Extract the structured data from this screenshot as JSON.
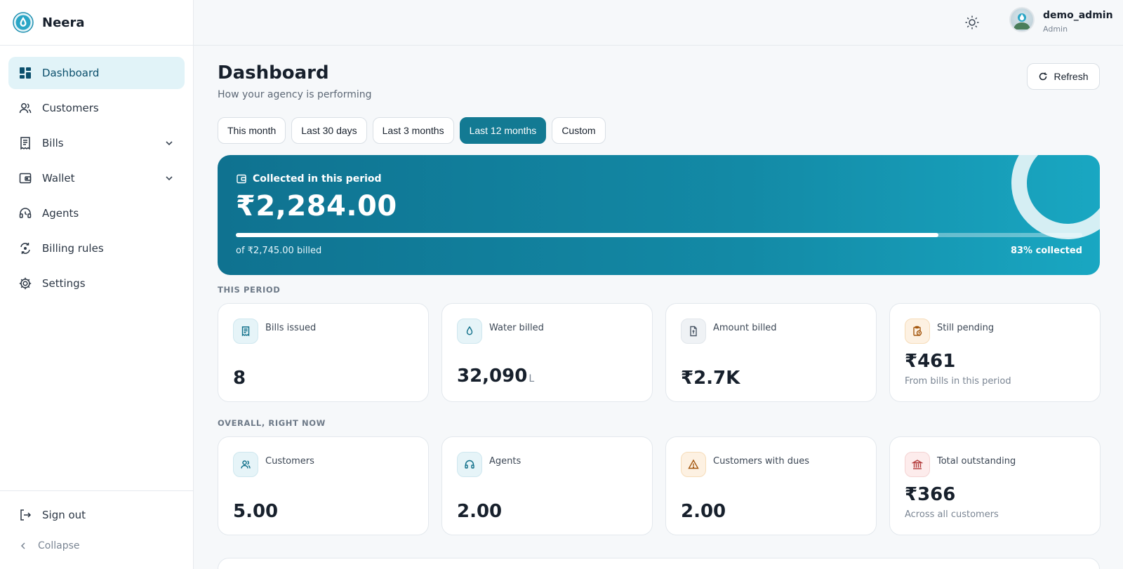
{
  "brand": {
    "name": "Neera",
    "logo_icon": "water-drop-logo-icon"
  },
  "sidebar": {
    "items": [
      {
        "label": "Dashboard",
        "icon": "dashboard-icon",
        "active": true
      },
      {
        "label": "Customers",
        "icon": "users-icon"
      },
      {
        "label": "Bills",
        "icon": "receipt-icon",
        "expandable": true
      },
      {
        "label": "Wallet",
        "icon": "wallet-icon",
        "expandable": true
      },
      {
        "label": "Agents",
        "icon": "headset-icon"
      },
      {
        "label": "Billing rules",
        "icon": "rules-icon"
      },
      {
        "label": "Settings",
        "icon": "gear-icon"
      }
    ],
    "footer": {
      "sign_out": "Sign out",
      "collapse": "Collapse"
    }
  },
  "user": {
    "name": "demo_admin",
    "role": "Admin"
  },
  "header": {
    "title": "Dashboard",
    "subtitle": "How your agency is performing",
    "refresh_label": "Refresh"
  },
  "filters": {
    "options": [
      "This month",
      "Last 30 days",
      "Last 3 months",
      "Last 12 months",
      "Custom"
    ],
    "selected": "Last 12 months"
  },
  "hero": {
    "label": "Collected in this period",
    "amount": "₹2,284.00",
    "billed_text": "of ₹2,745.00 billed",
    "percent_text": "83% collected",
    "progress_fraction": 0.83
  },
  "sections": {
    "this_period": {
      "label": "THIS PERIOD",
      "cards": [
        {
          "title": "Bills issued",
          "value": "8",
          "icon": "receipt-icon",
          "tone": "blue"
        },
        {
          "title": "Water billed",
          "value": "32,090",
          "unit": "L",
          "icon": "water-drop-icon",
          "tone": "blue"
        },
        {
          "title": "Amount billed",
          "value": "₹2.7K",
          "icon": "document-icon",
          "tone": "gray"
        },
        {
          "title": "Still pending",
          "value": "₹461",
          "sub": "From bills in this period",
          "icon": "clipboard-clock-icon",
          "tone": "amber"
        }
      ]
    },
    "overall": {
      "label": "OVERALL, RIGHT NOW",
      "cards": [
        {
          "title": "Customers",
          "value": "5.00",
          "icon": "users-icon",
          "tone": "blue"
        },
        {
          "title": "Agents",
          "value": "2.00",
          "icon": "headset-icon",
          "tone": "blue"
        },
        {
          "title": "Customers with dues",
          "value": "2.00",
          "icon": "warning-icon",
          "tone": "amber"
        },
        {
          "title": "Total outstanding",
          "value": "₹366",
          "sub": "Across all customers",
          "icon": "bank-icon",
          "tone": "red"
        }
      ]
    }
  },
  "colors": {
    "accent": "#137a93",
    "hero_start": "#0f7290",
    "hero_end": "#19a7c2",
    "active_nav_bg": "#e1f3f8"
  }
}
